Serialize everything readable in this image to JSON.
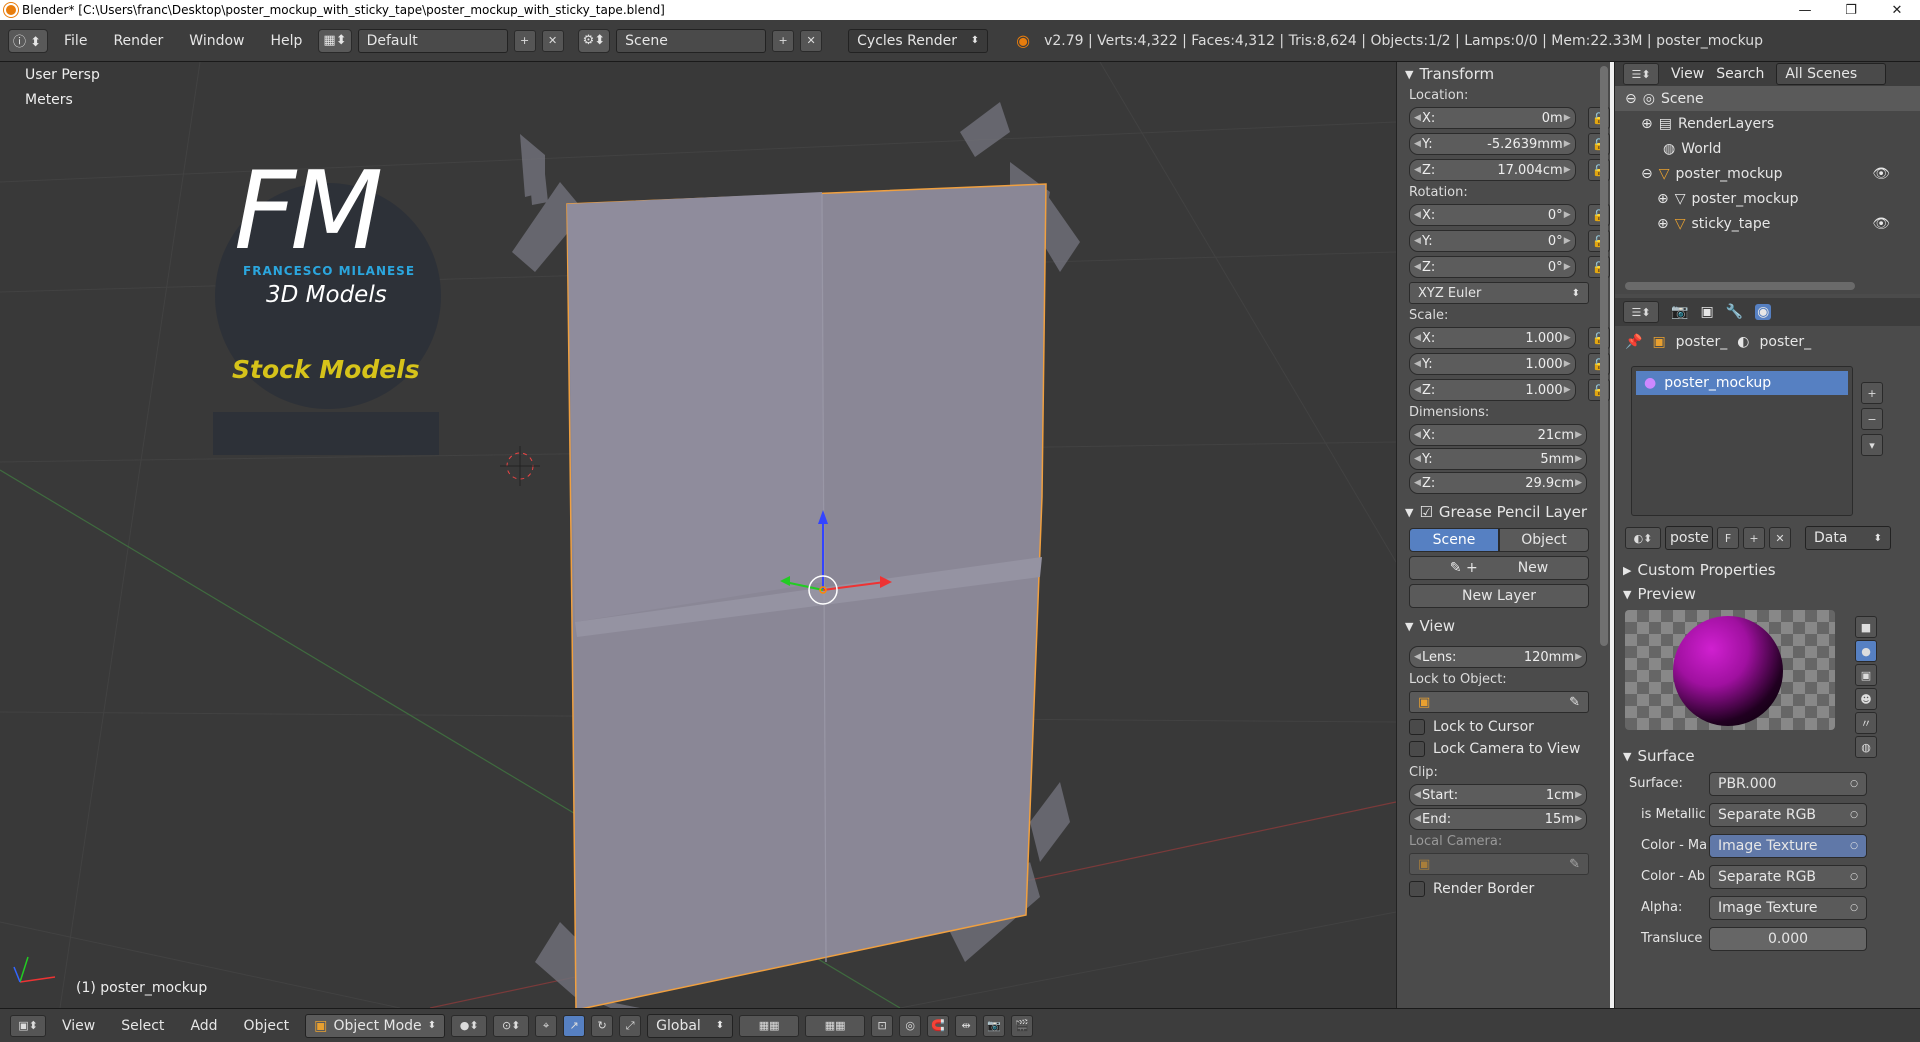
{
  "window": {
    "title": "Blender* [C:\\Users\\franc\\Desktop\\poster_mockup_with_sticky_tape\\poster_mockup_with_sticky_tape.blend]",
    "min": "—",
    "max": "❐",
    "close": "✕"
  },
  "topbar": {
    "menus": [
      "File",
      "Render",
      "Window",
      "Help"
    ],
    "layout": "Default",
    "scene": "Scene",
    "engine": "Cycles Render",
    "stats": "v2.79 | Verts:4,322 | Faces:4,312 | Tris:8,624 | Objects:1/2 | Lamps:0/0 | Mem:22.33M | poster_mockup"
  },
  "viewport": {
    "view_name": "User Persp",
    "units": "Meters",
    "object_label": "(1) poster_mockup",
    "logo": {
      "initials": "FM",
      "name": "FRANCESCO MILANESE",
      "subtitle": "3D Models",
      "banner": "Stock Models"
    }
  },
  "npanel": {
    "transform_title": "Transform",
    "location_label": "Location:",
    "location": [
      {
        "axis": "X:",
        "value": "0m"
      },
      {
        "axis": "Y:",
        "value": "-5.2639mm"
      },
      {
        "axis": "Z:",
        "value": "17.004cm"
      }
    ],
    "rotation_label": "Rotation:",
    "rotation": [
      {
        "axis": "X:",
        "value": "0°"
      },
      {
        "axis": "Y:",
        "value": "0°"
      },
      {
        "axis": "Z:",
        "value": "0°"
      }
    ],
    "rotation_mode": "XYZ Euler",
    "scale_label": "Scale:",
    "scale": [
      {
        "axis": "X:",
        "value": "1.000"
      },
      {
        "axis": "Y:",
        "value": "1.000"
      },
      {
        "axis": "Z:",
        "value": "1.000"
      }
    ],
    "dimensions_label": "Dimensions:",
    "dimensions": [
      {
        "axis": "X:",
        "value": "21cm"
      },
      {
        "axis": "Y:",
        "value": "5mm"
      },
      {
        "axis": "Z:",
        "value": "29.9cm"
      }
    ],
    "grease_title": "Grease Pencil Layer",
    "gp_scene": "Scene",
    "gp_object": "Object",
    "gp_new": "New",
    "gp_new_layer": "New Layer",
    "view_title": "View",
    "lens_label": "Lens:",
    "lens_value": "120mm",
    "lock_to_object": "Lock to Object:",
    "lock_to_cursor": "Lock to Cursor",
    "lock_camera": "Lock Camera to View",
    "clip_label": "Clip:",
    "clip_start_label": "Start:",
    "clip_start": "1cm",
    "clip_end_label": "End:",
    "clip_end": "15m",
    "local_camera": "Local Camera:",
    "render_border": "Render Border"
  },
  "outliner": {
    "view": "View",
    "search": "Search",
    "filter": "All Scenes",
    "items": [
      "Scene",
      "RenderLayers",
      "World",
      "poster_mockup",
      "poster_mockup",
      "sticky_tape"
    ]
  },
  "properties": {
    "breadcrumb": [
      "poster_",
      "poster_"
    ],
    "material": "poster_mockup",
    "mat_short": "poste",
    "mat_f": "F",
    "link": "Data",
    "custom_props": "Custom Properties",
    "preview": "Preview",
    "surface_title": "Surface",
    "surface_label": "Surface:",
    "surface_value": "PBR.000",
    "sockets": [
      {
        "name": "is Metallic",
        "value": "Separate RGB"
      },
      {
        "name": "Color - Ma",
        "value": "Image Texture"
      },
      {
        "name": "Color - Ab",
        "value": "Separate RGB"
      },
      {
        "name": "Alpha:",
        "value": "Image Texture"
      },
      {
        "name": "Transluce",
        "value": "0.000"
      }
    ]
  },
  "bottombar": {
    "menus": [
      "View",
      "Select",
      "Add",
      "Object"
    ],
    "mode": "Object Mode",
    "orientation": "Global"
  }
}
